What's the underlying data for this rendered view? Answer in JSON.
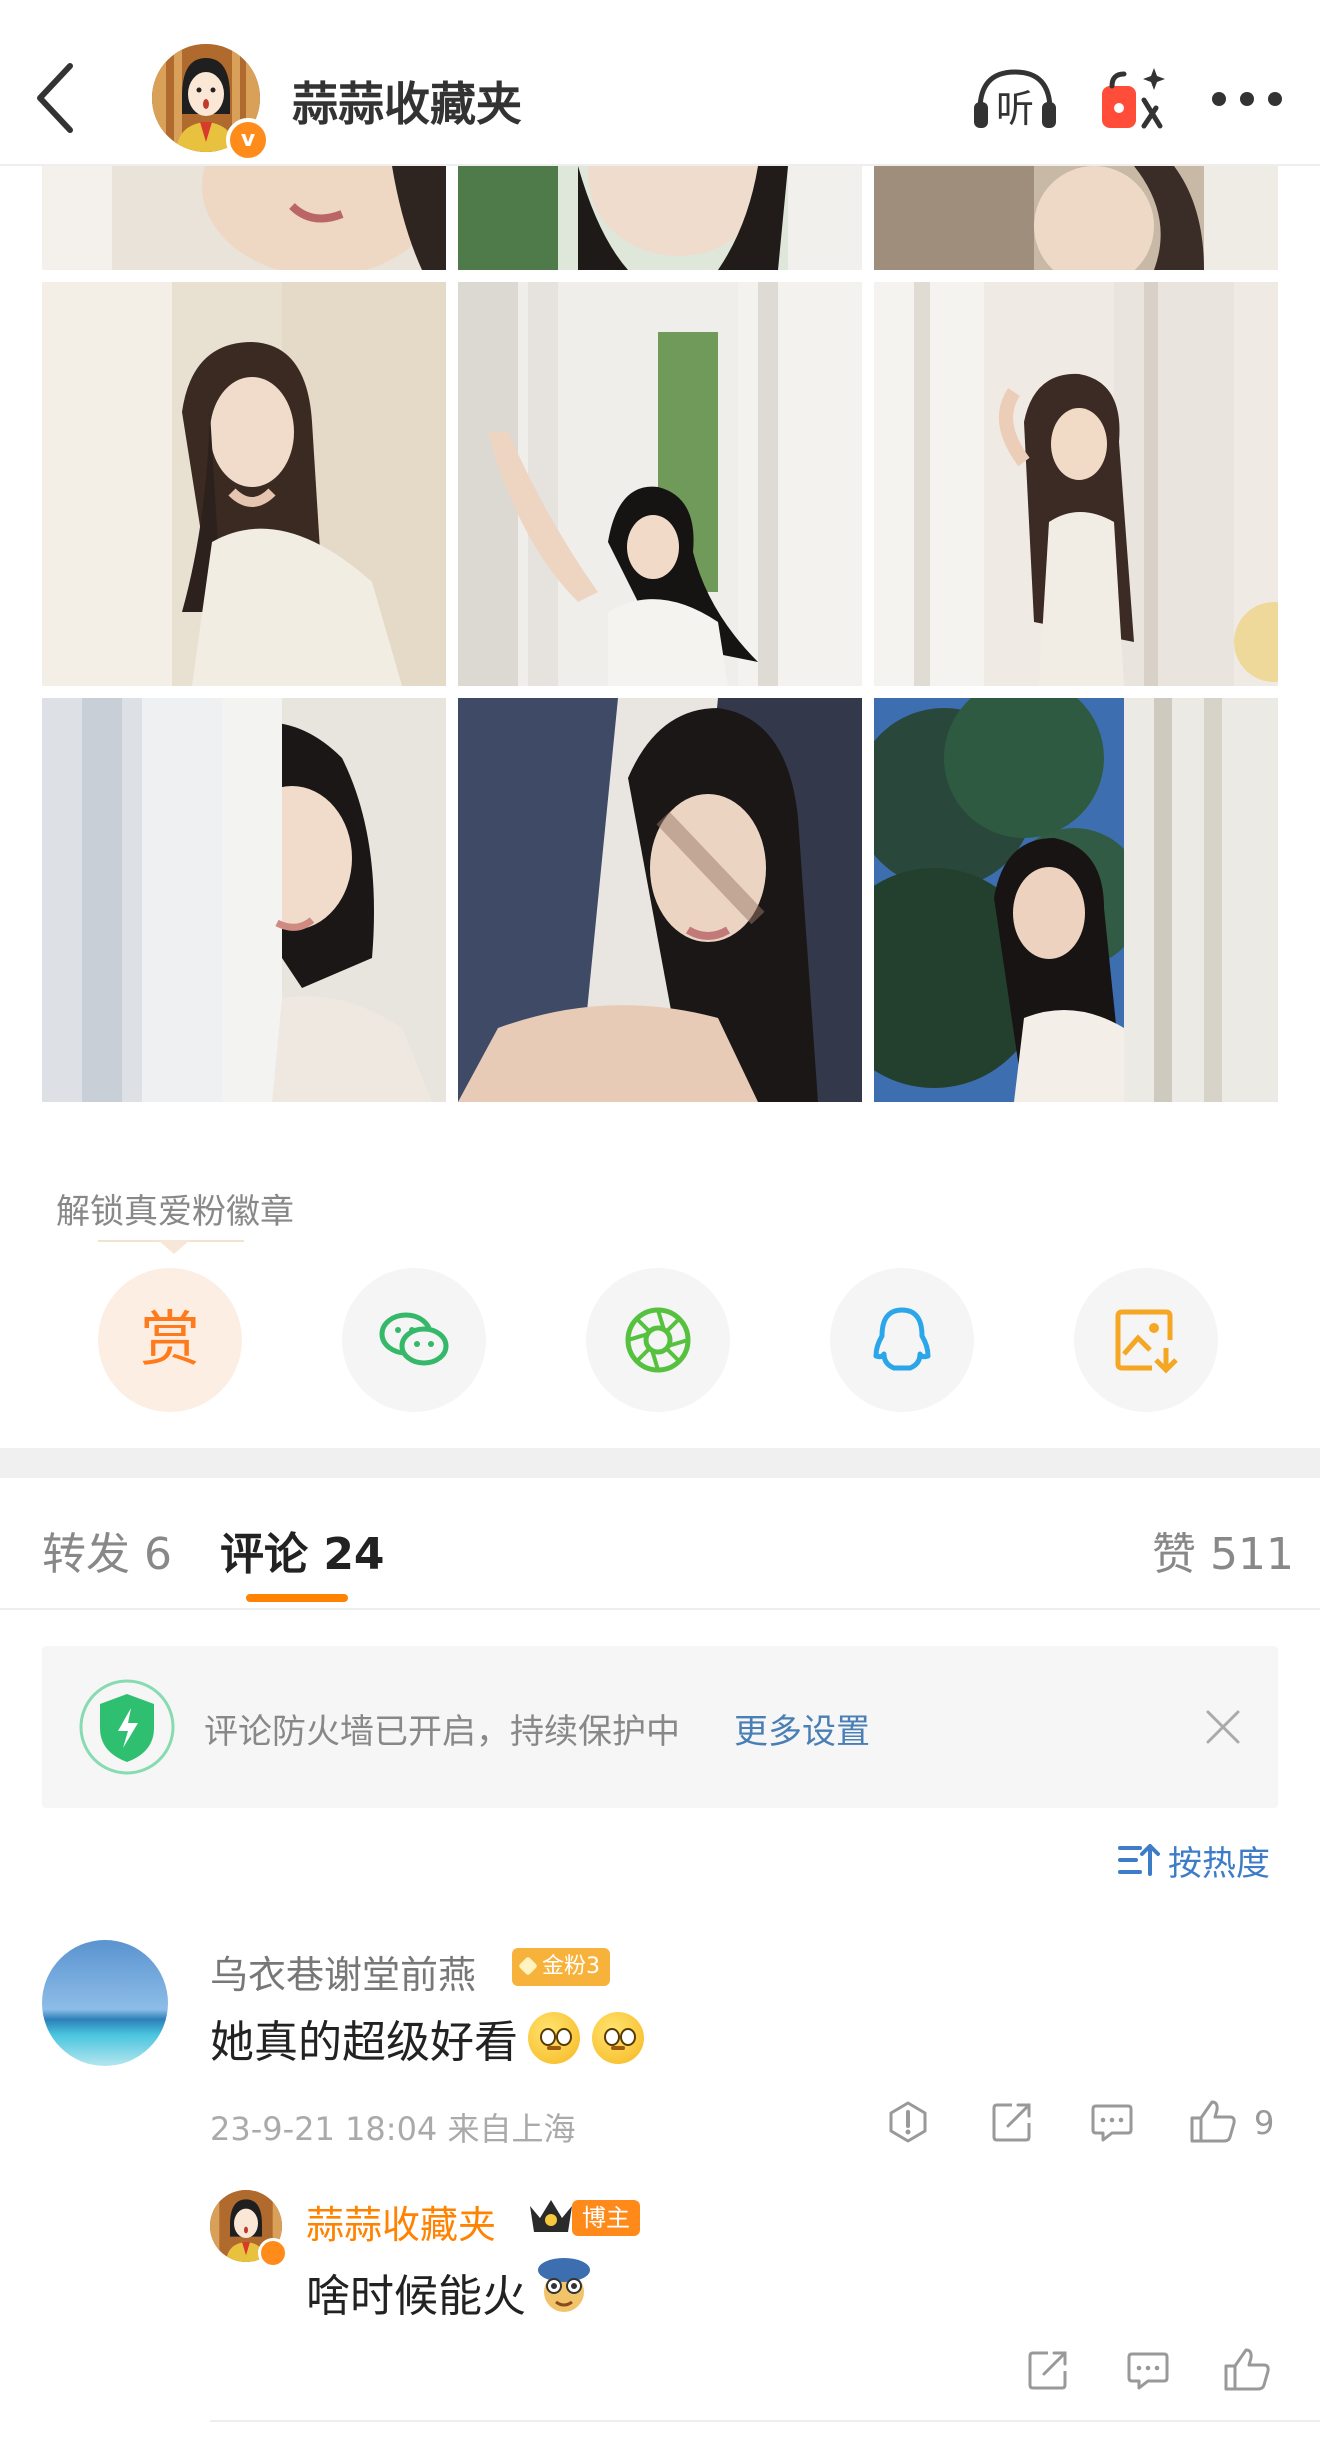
{
  "header": {
    "title": "蒜蒜收藏夹",
    "listen_label": "听",
    "back_icon": "back-arrow-icon",
    "more_icon": "more-dots-icon"
  },
  "photos": [
    {
      "name": "photo-1",
      "kind": "partial"
    },
    {
      "name": "photo-2",
      "kind": "partial"
    },
    {
      "name": "photo-3",
      "kind": "partial"
    },
    {
      "name": "photo-4"
    },
    {
      "name": "photo-5"
    },
    {
      "name": "photo-6"
    },
    {
      "name": "photo-7"
    },
    {
      "name": "photo-8"
    },
    {
      "name": "photo-9"
    }
  ],
  "unlock": {
    "label": "解锁真爱粉徽章"
  },
  "share": {
    "reward_label": "赏",
    "items": [
      "reward",
      "wechat",
      "moments",
      "qq",
      "save-image"
    ]
  },
  "tabs": {
    "repost": "转发 6",
    "comment": "评论 24",
    "like": "赞 511"
  },
  "firewall": {
    "text": "评论防火墙已开启，持续保护中",
    "link": "更多设置"
  },
  "sort": {
    "label": "按热度"
  },
  "comment": {
    "username": "乌衣巷谢堂前燕",
    "fan_badge": "金粉3",
    "text": "她真的超级好看",
    "meta": "23-9-21 18:04  来自上海",
    "like_count": "9"
  },
  "reply": {
    "username": "蒜蒜收藏夹",
    "role_badge": "博主",
    "text": "啥时候能火"
  },
  "colors": {
    "accent": "#ff8200",
    "link": "#4a7fb5",
    "sort": "#3f7cc7",
    "gold_badge": "#f7b23b"
  }
}
